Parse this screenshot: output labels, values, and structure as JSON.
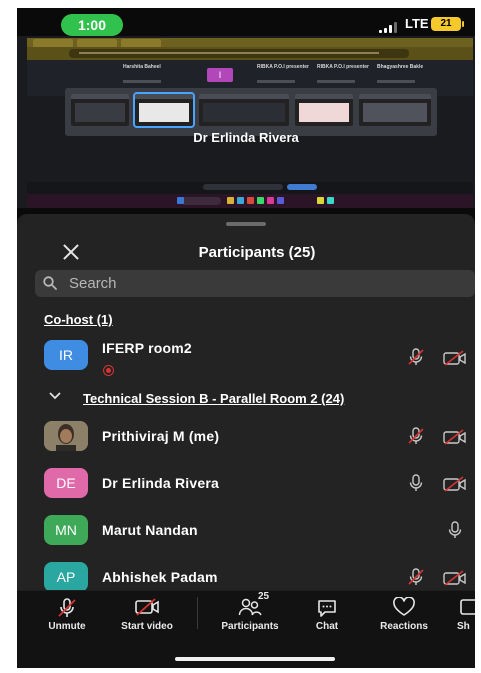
{
  "status_bar": {
    "time": "1:00",
    "network": "LTE",
    "battery": "21"
  },
  "shared_screen": {
    "speaker_name": "Dr Erlinda Rivera",
    "top_names": [
      "Harshita Baheel",
      "RIBKA P.O.I presenter",
      "RIBKA P.O.I presenter",
      "Bhagyashree Bakle"
    ],
    "purple_tile": "I"
  },
  "participants_panel": {
    "title": "Participants (25)",
    "close_icon": "close-icon",
    "search_placeholder": "Search",
    "cohost_section": {
      "label": "Co-host (1)",
      "members": [
        {
          "initials": "IR",
          "name": "IFERP  room2",
          "avatar_color": "#3f8de3",
          "recording": true,
          "mic": "muted",
          "video": "off"
        }
      ]
    },
    "group_section": {
      "label": "Technical Session B - Parallel Room 2 (24)",
      "members": [
        {
          "initials": "",
          "name": "Prithiviraj M (me)",
          "avatar_color": "#7a6a55",
          "photo": true,
          "mic": "muted",
          "video": "off"
        },
        {
          "initials": "DE",
          "name": "Dr Erlinda Rivera",
          "avatar_color": "#e06aa9",
          "mic": "on",
          "video": "off"
        },
        {
          "initials": "MN",
          "name": "Marut Nandan",
          "avatar_color": "#3fa95a",
          "mic": "on",
          "video": "none"
        },
        {
          "initials": "AP",
          "name": "Abhishek Padam",
          "avatar_color": "#2aa7a0",
          "mic": "muted",
          "video": "off"
        }
      ]
    }
  },
  "toolbar": {
    "unmute": "Unmute",
    "start_video": "Start video",
    "participants": "Participants",
    "participants_count": "25",
    "chat": "Chat",
    "reactions": "Reactions",
    "share": "Sh"
  },
  "colors": {
    "accent_red": "#d63333",
    "sheet_bg": "#232323",
    "screen_bg": "#0a0a0a"
  }
}
